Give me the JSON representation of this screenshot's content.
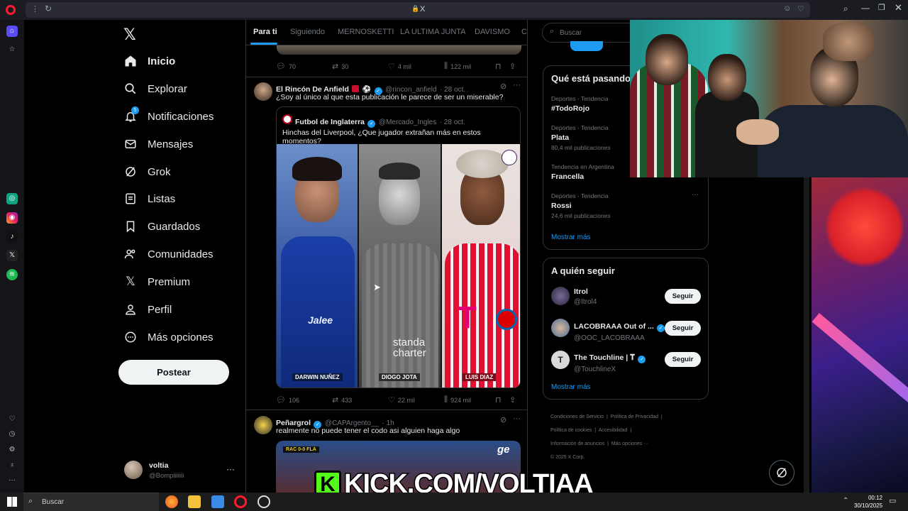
{
  "browser": {
    "address": "X"
  },
  "nav": {
    "items": [
      {
        "label": "Inicio"
      },
      {
        "label": "Explorar"
      },
      {
        "label": "Notificaciones",
        "badge": "5"
      },
      {
        "label": "Mensajes"
      },
      {
        "label": "Grok"
      },
      {
        "label": "Listas"
      },
      {
        "label": "Guardados"
      },
      {
        "label": "Comunidades"
      },
      {
        "label": "Premium"
      },
      {
        "label": "Perfil"
      },
      {
        "label": "Más opciones"
      }
    ],
    "post_label": "Postear",
    "account": {
      "name": "voltia",
      "handle": "@Bompiiiiiii"
    }
  },
  "tabs": [
    "Para ti",
    "Siguiendo",
    "MERNOSKETTI",
    "LA ULTIMA JUNTA",
    "DAVISMO",
    "Co"
  ],
  "tweets": {
    "prev_metrics": {
      "replies": "70",
      "retweets": "30",
      "likes": "4 mil",
      "views": "122 mil"
    },
    "t1": {
      "name": "El Rincón De Anfield",
      "handle": "@rincon_anfield",
      "date": "· 28 oct.",
      "text": "¿Soy al único al que esta publicación le parece de ser un miserable?",
      "quote": {
        "name": "Futbol de Inglaterra",
        "handle": "@Mercado_Ingles",
        "date": "· 28 oct.",
        "text": "Hinchas del Liverpool, ¿Que jugador extrañan más en estos momentos?",
        "players": [
          "DARWIN NUÑEZ",
          "DIOGO JOTA",
          "LUIS DIAZ"
        ],
        "shirt_text": "Jalee",
        "sponsor": "standa charter"
      },
      "metrics": {
        "replies": "106",
        "retweets": "433",
        "likes": "22 mil",
        "views": "924 mil"
      }
    },
    "t2": {
      "name": "Peñargrol",
      "handle": "@CAPArgento__",
      "date": "· 1h",
      "text": "realmente no puede tener el codo asi alguien haga algo",
      "scoreboard": "RAC 0-0 FLA",
      "tv_logo": "ge"
    }
  },
  "right": {
    "search_placeholder": "Buscar",
    "trends_title": "Qué está pasando",
    "trends": [
      {
        "meta": "Deportes · Tendencia",
        "name": "#TodoRojo",
        "count": ""
      },
      {
        "meta": "Deportes · Tendencia",
        "name": "Plata",
        "count": "80,4 mil publicaciones"
      },
      {
        "meta": "Tendencia en Argentina",
        "name": "Francella",
        "count": ""
      },
      {
        "meta": "Deportes · Tendencia",
        "name": "Rossi",
        "count": "24,6 mil publicaciones"
      }
    ],
    "show_more": "Mostrar más",
    "follow_title": "A quién seguir",
    "follow": [
      {
        "name": "Itrol",
        "handle": "@Itrol4",
        "verified": false
      },
      {
        "name": "LACOBRAAA Out of ...",
        "handle": "@OOC_LACOBRAAA",
        "verified": true
      },
      {
        "name": "The Touchline | 𝐓",
        "handle": "@TouchlineX",
        "verified": true
      }
    ],
    "follow_btn": "Seguir",
    "footer": [
      "Condiciones de Servicio",
      "Política de Privacidad",
      "Política de cookies",
      "Accesibilidad",
      "Información de anuncios",
      "Más opciones ···",
      "© 2025 X Corp."
    ]
  },
  "overlay": {
    "kick": "KICK.COM/VOLTIAA"
  },
  "taskbar": {
    "search": "Buscar",
    "time": "00:12",
    "date": "30/10/2025"
  },
  "colors": {
    "accent": "#1d9bf0",
    "kick_green": "#53fc18",
    "opera_red": "#ff1b2d"
  }
}
